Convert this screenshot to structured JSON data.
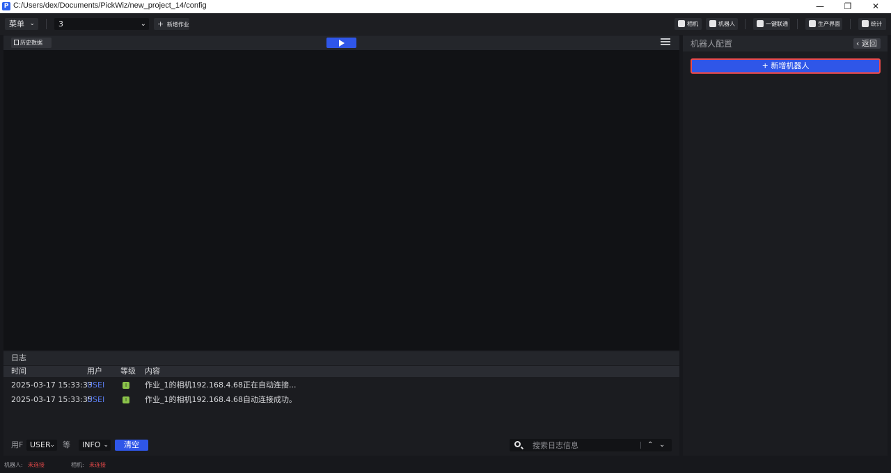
{
  "titlebar": {
    "app_icon_letter": "P",
    "path": "C:/Users/dex/Documents/PickWiz/new_project_14/config",
    "minimize": "—",
    "restore": "❐",
    "close": "✕"
  },
  "toolbar": {
    "menu_label": "菜单",
    "job_value": "3",
    "new_job_label": "新增作业",
    "camera_label": "相机",
    "robot_label": "机器人",
    "ai_label": "一键联通",
    "production_label": "生产界面",
    "stats_label": "统计"
  },
  "main": {
    "history_label": "历史数据"
  },
  "log": {
    "title": "日志",
    "columns": {
      "time": "时间",
      "user": "用户",
      "level": "等级",
      "content": "内容"
    },
    "rows": [
      {
        "time": "2025-03-17 15:33:33",
        "user": "USEI",
        "level": "I",
        "content": "作业_1的相机192.168.4.68正在自动连接..."
      },
      {
        "time": "2025-03-17 15:33:35",
        "user": "USEI",
        "level": "I",
        "content": "作业_1的相机192.168.4.68自动连接成功。"
      }
    ],
    "footer": {
      "user_label": "用F",
      "user_value": "USER",
      "level_label": "等",
      "level_value": "INFO",
      "clear_label": "清空",
      "search_placeholder": "搜索日志信息"
    }
  },
  "right_panel": {
    "title": "机器人配置",
    "back_label": "返回",
    "add_robot_label": "+ 新增机器人"
  },
  "statusbar": {
    "robot_label": "机器人:",
    "robot_status": "未连接",
    "camera_label": "相机:",
    "camera_status": "未连接"
  },
  "colors": {
    "accent": "#2f56e8",
    "highlight_border": "#ec4b4b",
    "status_error": "#e34848",
    "level_info": "#8bc34a"
  }
}
